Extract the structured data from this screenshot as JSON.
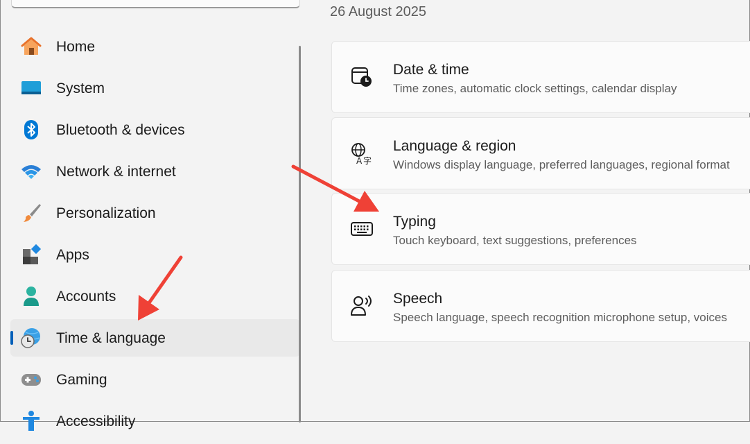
{
  "header": {
    "date": "26 August 2025"
  },
  "sidebar": {
    "items": [
      {
        "label": "Home",
        "icon": "home-icon"
      },
      {
        "label": "System",
        "icon": "system-icon"
      },
      {
        "label": "Bluetooth & devices",
        "icon": "bluetooth-icon"
      },
      {
        "label": "Network & internet",
        "icon": "wifi-icon"
      },
      {
        "label": "Personalization",
        "icon": "brush-icon"
      },
      {
        "label": "Apps",
        "icon": "apps-icon"
      },
      {
        "label": "Accounts",
        "icon": "person-icon"
      },
      {
        "label": "Time & language",
        "icon": "globe-clock-icon",
        "selected": true
      },
      {
        "label": "Gaming",
        "icon": "gamepad-icon"
      },
      {
        "label": "Accessibility",
        "icon": "accessibility-icon"
      }
    ]
  },
  "main": {
    "cards": [
      {
        "title": "Date & time",
        "subtitle": "Time zones, automatic clock settings, calendar display",
        "icon": "calendar-clock-icon"
      },
      {
        "title": "Language & region",
        "subtitle": "Windows display language, preferred languages, regional format",
        "icon": "language-icon"
      },
      {
        "title": "Typing",
        "subtitle": "Touch keyboard, text suggestions, preferences",
        "icon": "keyboard-icon"
      },
      {
        "title": "Speech",
        "subtitle": "Speech language, speech recognition microphone setup, voices",
        "icon": "speech-icon"
      }
    ]
  },
  "colors": {
    "accent": "#005fb8",
    "annotation_arrow": "#ef4136"
  }
}
